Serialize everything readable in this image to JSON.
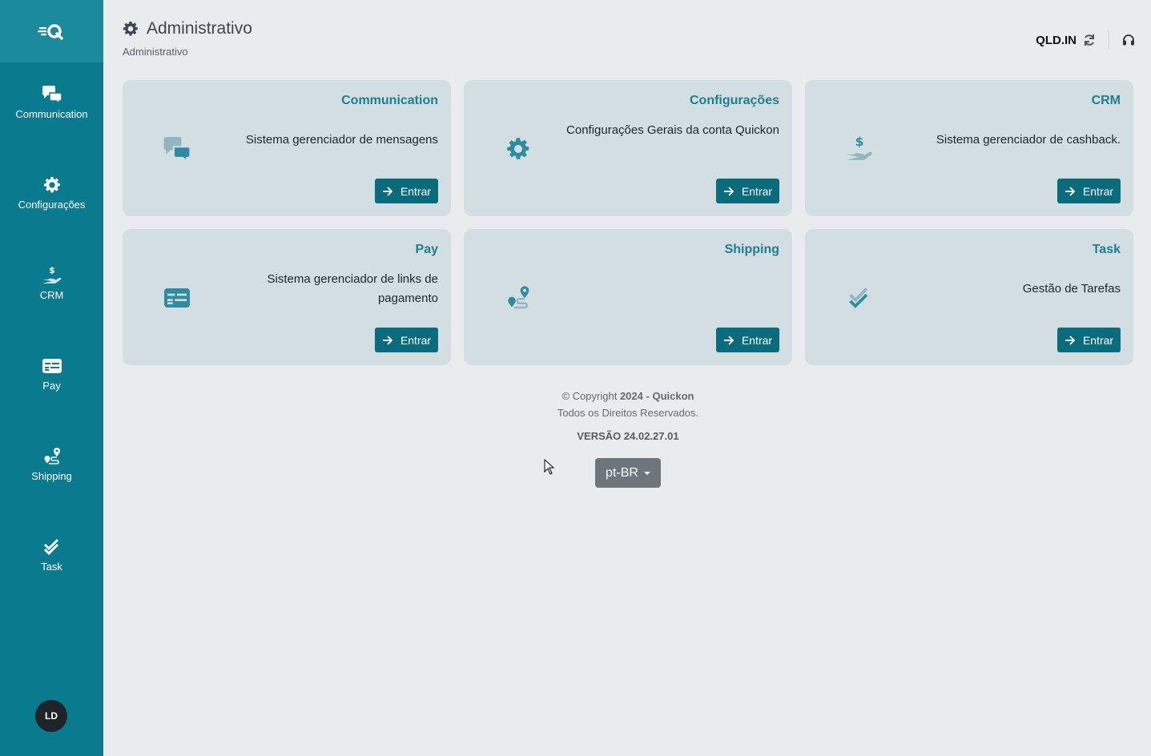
{
  "sidebar": {
    "logo_icon": "quickon-logo-icon",
    "items": [
      {
        "label": "Communication",
        "icon": "chat-bubbles-icon"
      },
      {
        "label": "Configurações",
        "icon": "gear-icon"
      },
      {
        "label": "CRM",
        "icon": "hand-dollar-icon"
      },
      {
        "label": "Pay",
        "icon": "card-icon"
      },
      {
        "label": "Shipping",
        "icon": "route-icon"
      },
      {
        "label": "Task",
        "icon": "check-double-icon"
      }
    ],
    "avatar": "LD"
  },
  "header": {
    "title": "Administrativo",
    "breadcrumb": "Administrativo",
    "company": "QLD.IN"
  },
  "cards": [
    {
      "title": "Communication",
      "description": "Sistema gerenciador de mensagens",
      "button": "Entrar",
      "icon": "chat-bubbles-icon"
    },
    {
      "title": "Configurações",
      "description": "Configurações Gerais da conta Quickon",
      "button": "Entrar",
      "icon": "gear-icon"
    },
    {
      "title": "CRM",
      "description": "Sistema gerenciador de cashback.",
      "button": "Entrar",
      "icon": "hand-dollar-icon"
    },
    {
      "title": "Pay",
      "description": "Sistema gerenciador de links de pagamento",
      "button": "Entrar",
      "icon": "card-icon"
    },
    {
      "title": "Shipping",
      "description": "",
      "button": "Entrar",
      "icon": "route-icon"
    },
    {
      "title": "Task",
      "description": "Gestão de Tarefas",
      "button": "Entrar",
      "icon": "check-double-icon"
    }
  ],
  "footer": {
    "copyright_prefix": "© Copyright",
    "year": "2024",
    "separator": "-",
    "company": "Quickon",
    "rights": "Todos os Direitos Reservados.",
    "version": "VERSÃO 24.02.27.01",
    "language": "pt-BR"
  },
  "colors": {
    "sidebar": "#0a7a8f",
    "accent": "#1e7e92",
    "button": "#0a6b7d",
    "card_bg": "#d3dee3",
    "page_bg": "#e8ecef"
  }
}
